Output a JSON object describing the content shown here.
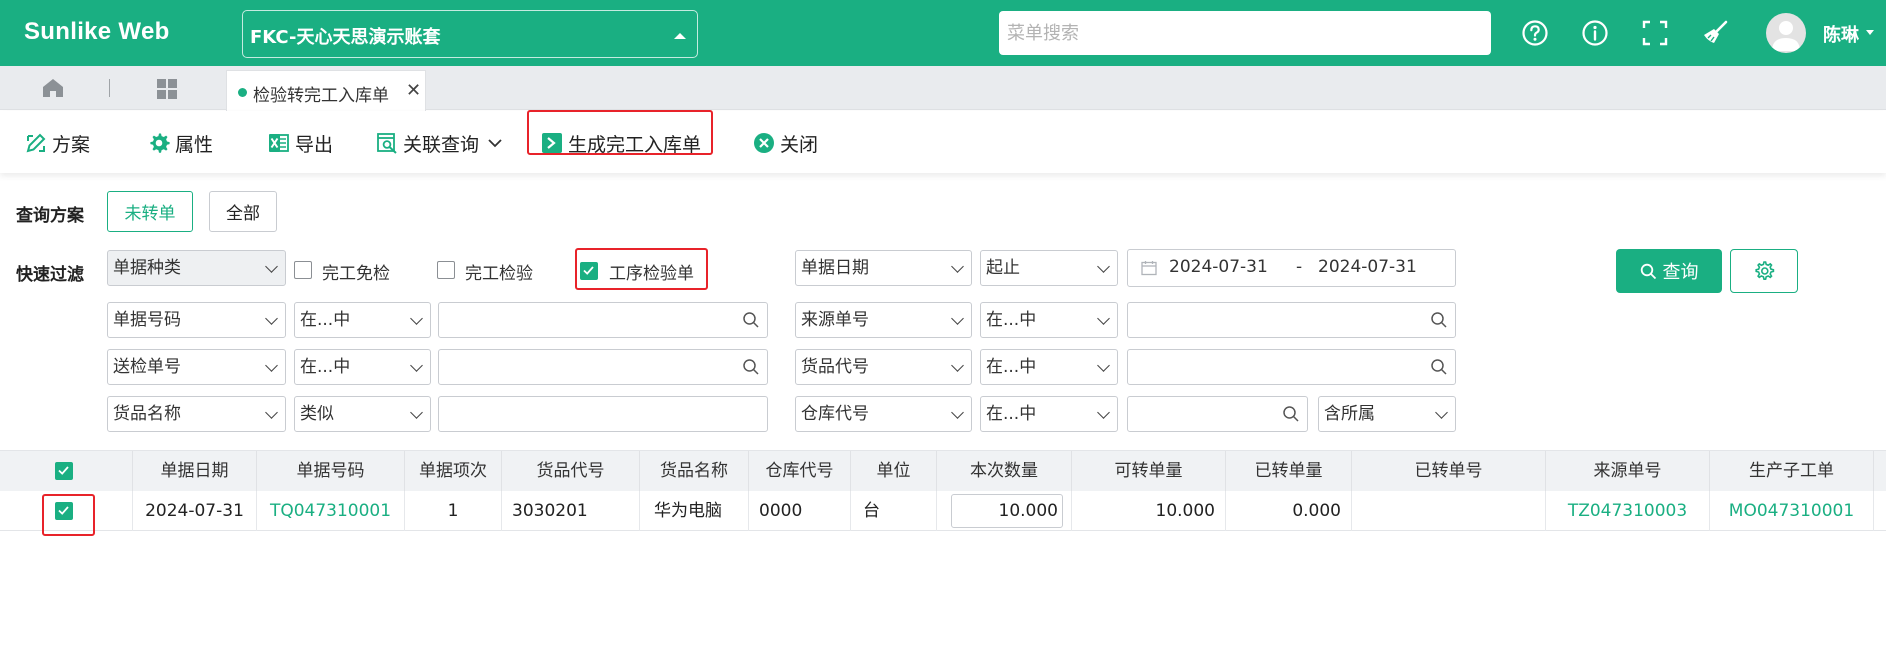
{
  "app": {
    "logo": "Sunlike Web",
    "account": "FKC-天心天思演示账套",
    "search_placeholder": "菜单搜索",
    "user_name": "陈琳"
  },
  "tabs": {
    "active_label": "检验转完工入库单",
    "close_glyph": "✕"
  },
  "toolbar": {
    "scheme": "方案",
    "properties": "属性",
    "export": "导出",
    "related_query": "关联查询",
    "generate": "生成完工入库单",
    "close": "关闭"
  },
  "filters": {
    "scheme_label": "查询方案",
    "scheme_options": [
      "未转单",
      "全部"
    ],
    "quick_label": "快速过滤",
    "doc_type": "单据种类",
    "checkboxes": [
      {
        "label": "完工免检",
        "checked": false
      },
      {
        "label": "完工检验",
        "checked": false
      },
      {
        "label": "工序检验单",
        "checked": true
      }
    ],
    "date_field": "单据日期",
    "date_mode": "起止",
    "date_from": "2024-07-31",
    "date_sep": "-",
    "date_to": "2024-07-31",
    "rows": [
      {
        "field": "单据号码",
        "op": "在...中",
        "field2": "来源单号",
        "op2": "在...中"
      },
      {
        "field": "送检单号",
        "op": "在...中",
        "field2": "货品代号",
        "op2": "在...中"
      },
      {
        "field": "货品名称",
        "op": "类似",
        "field2": "仓库代号",
        "op2": "在...中",
        "extra": "含所属"
      }
    ],
    "query_button": "查询"
  },
  "table": {
    "columns": [
      "单据日期",
      "单据号码",
      "单据项次",
      "货品代号",
      "货品名称",
      "仓库代号",
      "单位",
      "本次数量",
      "可转单量",
      "已转单量",
      "已转单号",
      "来源单号",
      "生产子工单"
    ],
    "rows": [
      {
        "checked": true,
        "date": "2024-07-31",
        "doc_no": "TQ047310001",
        "item_no": "1",
        "product_code": "3030201",
        "product_name": "华为电脑",
        "warehouse": "0000",
        "unit": "台",
        "qty": "10.000",
        "convertible_qty": "10.000",
        "converted_qty": "0.000",
        "converted_no": "",
        "source_no": "TZ047310003",
        "sub_order": "MO047310001"
      }
    ]
  },
  "colors": {
    "primary": "#1aaf82",
    "highlight": "#e8232a"
  }
}
